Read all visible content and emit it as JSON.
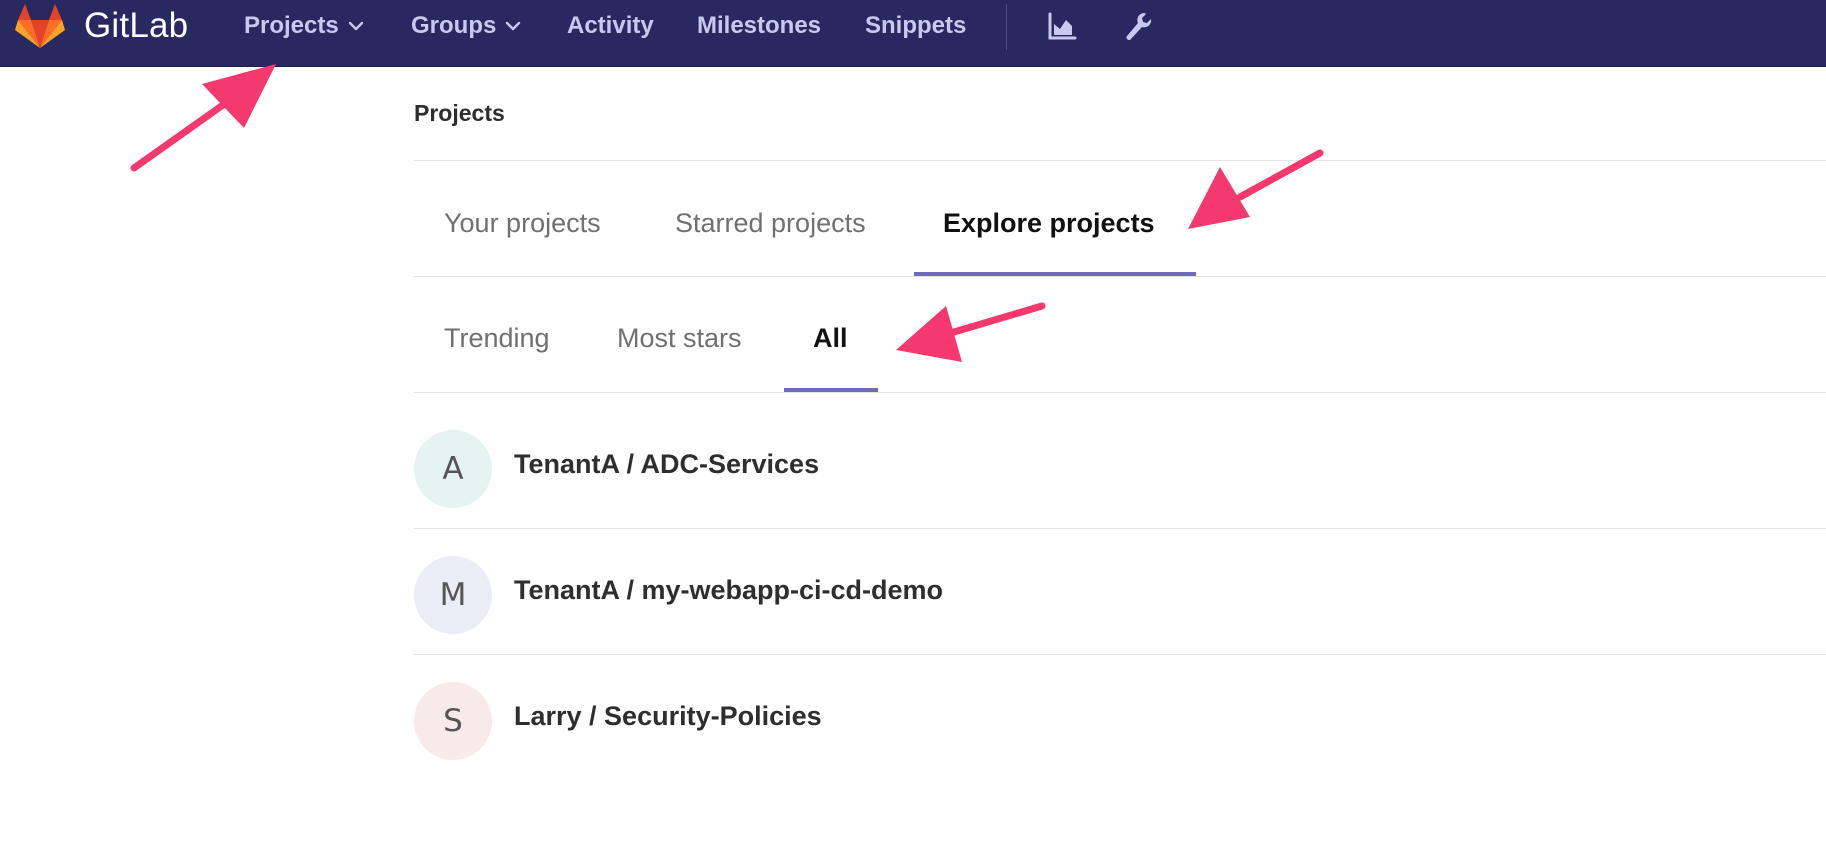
{
  "brand": {
    "name": "GitLab"
  },
  "nav": {
    "items": [
      {
        "label": "Projects",
        "has_dropdown": true
      },
      {
        "label": "Groups",
        "has_dropdown": true
      },
      {
        "label": "Activity",
        "has_dropdown": false
      },
      {
        "label": "Milestones",
        "has_dropdown": false
      },
      {
        "label": "Snippets",
        "has_dropdown": false
      }
    ],
    "icons": [
      "chart-icon",
      "wrench-icon"
    ]
  },
  "page": {
    "title": "Projects"
  },
  "primary_tabs": [
    {
      "label": "Your projects",
      "active": false
    },
    {
      "label": "Starred projects",
      "active": false
    },
    {
      "label": "Explore projects",
      "active": true
    }
  ],
  "secondary_tabs": [
    {
      "label": "Trending",
      "active": false
    },
    {
      "label": "Most stars",
      "active": false
    },
    {
      "label": "All",
      "active": true
    }
  ],
  "projects": [
    {
      "initial": "A",
      "name": "TenantA / ADC-Services",
      "avatar_color": "#e6f4f1"
    },
    {
      "initial": "M",
      "name": "TenantA / my-webapp-ci-cd-demo",
      "avatar_color": "#ececf7"
    },
    {
      "initial": "S",
      "name": "Larry / Security-Policies",
      "avatar_color": "#f9eaea"
    }
  ],
  "colors": {
    "navbar": "#292961",
    "nav_text": "#c9c9f0",
    "tab_underline": "#6b6bb8",
    "annotation_arrow": "#f5386e"
  }
}
